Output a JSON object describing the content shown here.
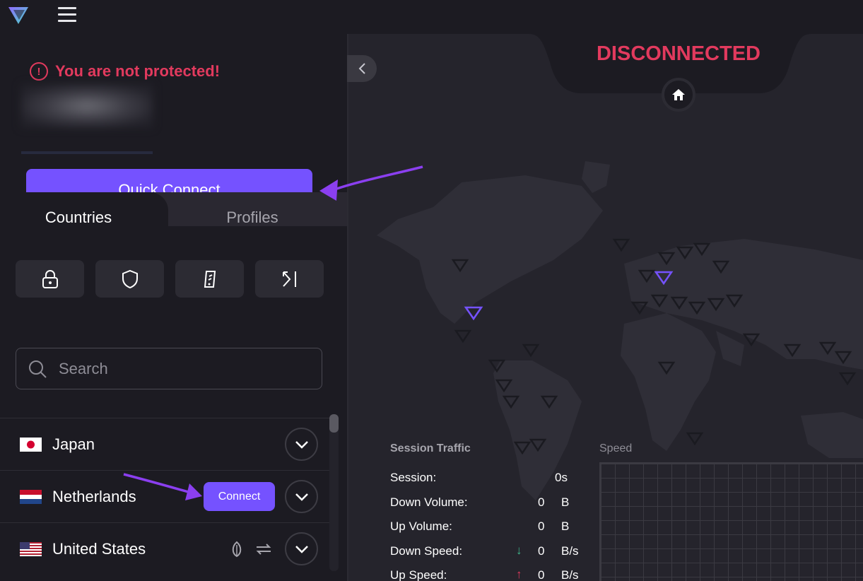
{
  "header": {
    "logo": "proton-vpn-logo",
    "menu_icon": "hamburger-menu-icon"
  },
  "status": {
    "warning": "You are not protected!",
    "title": "DISCONNECTED",
    "color": "#e23a5e"
  },
  "quick_connect": {
    "label": "Quick Connect"
  },
  "tabs": [
    {
      "label": "Countries",
      "active": true
    },
    {
      "label": "Profiles",
      "active": false
    }
  ],
  "filters": [
    {
      "icon": "lock-icon"
    },
    {
      "icon": "shield-icon"
    },
    {
      "icon": "smartphone-icon"
    },
    {
      "icon": "arrow-right-bar-icon"
    }
  ],
  "search": {
    "placeholder": "Search"
  },
  "countries": [
    {
      "name": "Japan",
      "flag": "jp"
    },
    {
      "name": "Netherlands",
      "flag": "nl",
      "connect_label": "Connect"
    },
    {
      "name": "United States",
      "flag": "us",
      "features": [
        "tor-icon",
        "p2p-icon"
      ]
    }
  ],
  "session_traffic": {
    "title": "Session Traffic",
    "rows": [
      {
        "label": "Session:",
        "value": "0s",
        "unit": ""
      },
      {
        "label": "Down Volume:",
        "value": "0",
        "unit": "B"
      },
      {
        "label": "Up Volume:",
        "value": "0",
        "unit": "B"
      },
      {
        "label": "Down Speed:",
        "value": "0",
        "unit": "B/s",
        "arrow": "↓"
      },
      {
        "label": "Up Speed:",
        "value": "0",
        "unit": "B/s",
        "arrow": "↑"
      }
    ]
  },
  "speed": {
    "label": "Speed"
  },
  "colors": {
    "accent": "#7552ff",
    "danger": "#e23a5e",
    "bg": "#1c1b22",
    "map": "#25242c"
  }
}
